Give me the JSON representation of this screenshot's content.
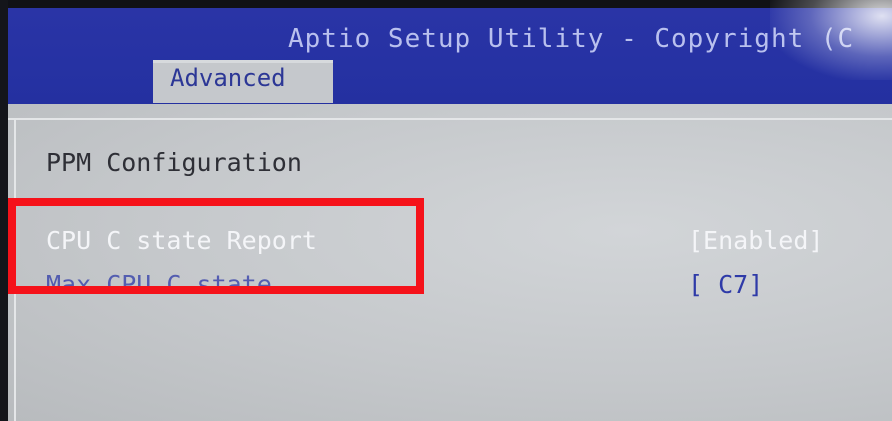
{
  "header": {
    "title": "Aptio Setup Utility - Copyright (C",
    "active_tab": "Advanced"
  },
  "page": {
    "section_title": "PPM Configuration",
    "settings": [
      {
        "label": "CPU C state Report",
        "value": "[Enabled]",
        "selected": true
      },
      {
        "label": "Max CPU C state",
        "value": "[ C7]",
        "selected": false
      }
    ]
  },
  "annotation": {
    "highlight_color": "#f5121a"
  },
  "colors": {
    "header_bg": "#2632a3",
    "body_bg": "#c5c8cb",
    "selected_text": "#f4f5f8",
    "option_text": "#2e3aa8"
  }
}
